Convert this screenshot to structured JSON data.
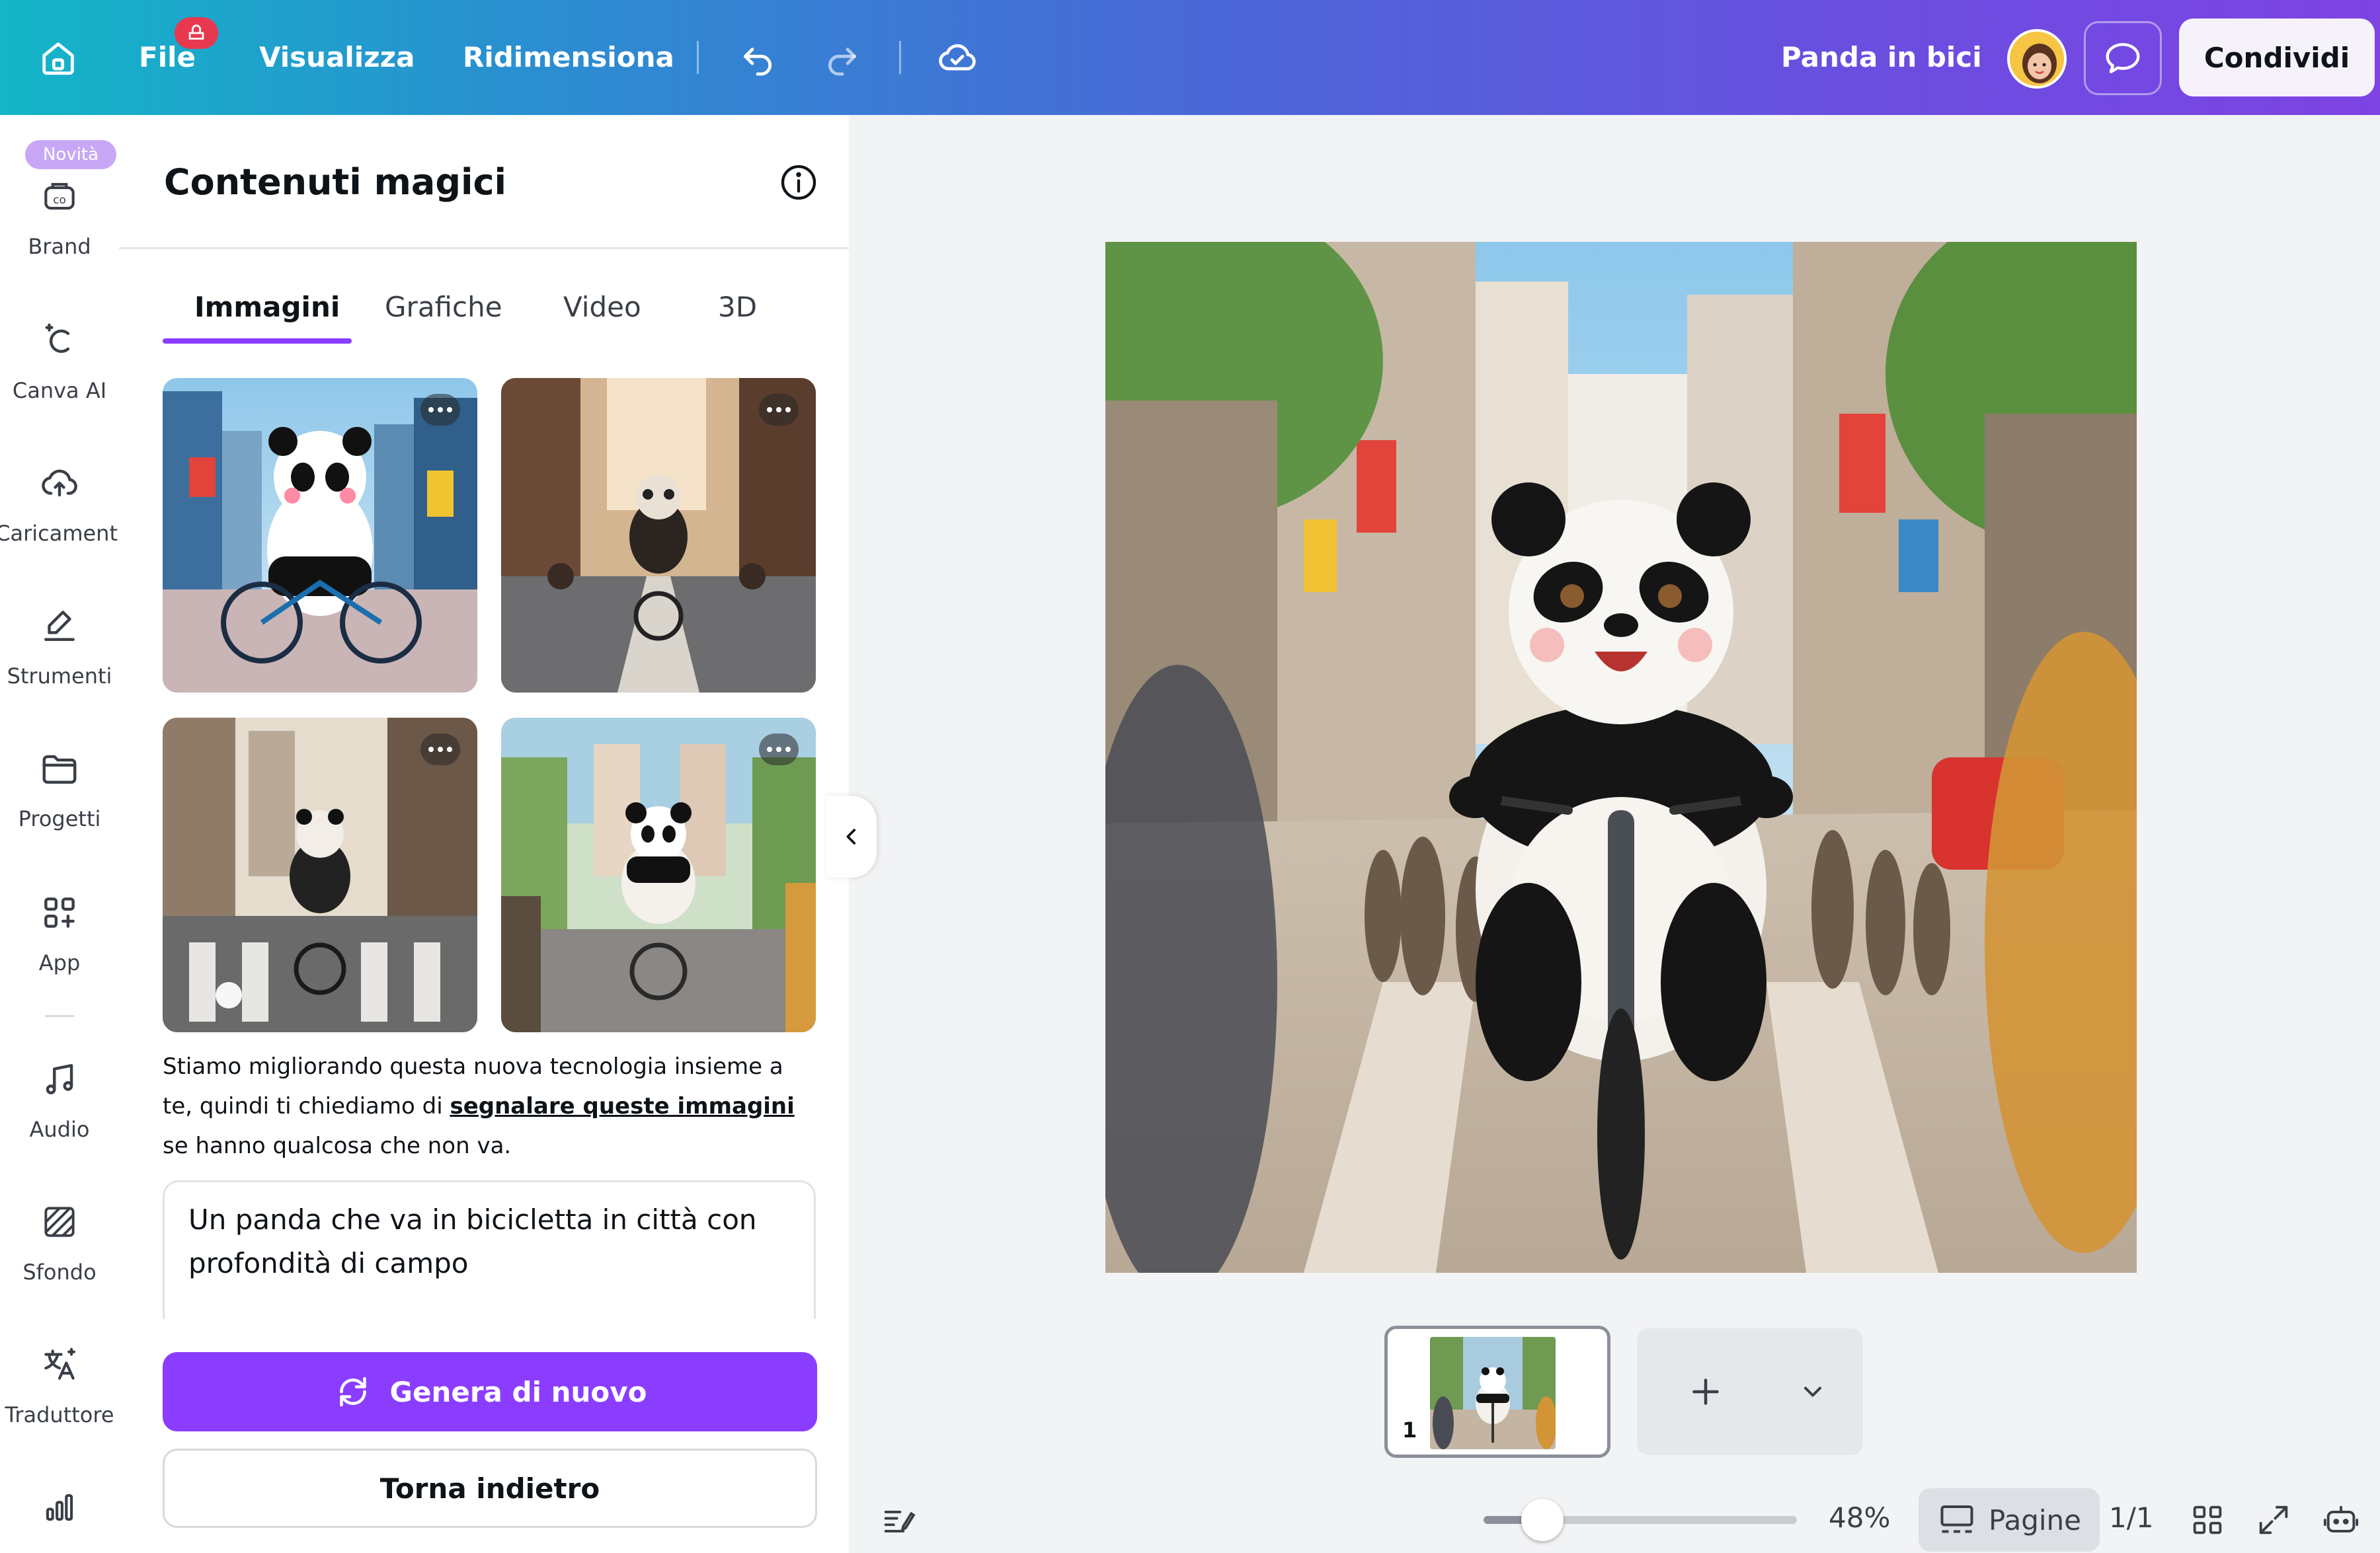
{
  "topbar": {
    "menu": {
      "file": "File",
      "view": "Visualizza",
      "resize": "Ridimensiona"
    },
    "project_title": "Panda in bici",
    "share_label": "Condividi"
  },
  "rail": {
    "new_badge": "Novità",
    "items": [
      {
        "label": "Brand",
        "icon": "brand-icon"
      },
      {
        "label": "Canva AI",
        "icon": "canva-ai-icon"
      },
      {
        "label": "Caricamenti",
        "icon": "upload-cloud-icon"
      },
      {
        "label": "Strumenti",
        "icon": "draw-tools-icon"
      },
      {
        "label": "Progetti",
        "icon": "folder-icon"
      },
      {
        "label": "App",
        "icon": "apps-icon"
      },
      {
        "label": "Audio",
        "icon": "music-note-icon"
      },
      {
        "label": "Sfondo",
        "icon": "background-pattern-icon"
      },
      {
        "label": "Traduttore",
        "icon": "translate-icon"
      }
    ]
  },
  "panel": {
    "title": "Contenuti magici",
    "tabs": [
      {
        "label": "Immagini",
        "active": true
      },
      {
        "label": "Grafiche",
        "active": false
      },
      {
        "label": "Video",
        "active": false
      },
      {
        "label": "3D",
        "active": false
      }
    ],
    "notice": {
      "before": "Stiamo migliorando questa nuova tecnologia insieme a te, quindi ti chiediamo di ",
      "link": "segnalare queste immagini",
      "after": " se hanno qualcosa che non va."
    },
    "prompt": "Un panda che va in bicicletta in città con profondità di campo",
    "generate_label": "Genera di nuovo",
    "back_label": "Torna indietro"
  },
  "footer": {
    "page_number": "1",
    "zoom": {
      "value": 0.48,
      "label": "48%"
    },
    "pages_label": "Pagine",
    "page_count": "1/1"
  },
  "colors": {
    "accent": "#8b3dff",
    "topbar_start": "#13b5c7",
    "topbar_end": "#7d43e3"
  }
}
